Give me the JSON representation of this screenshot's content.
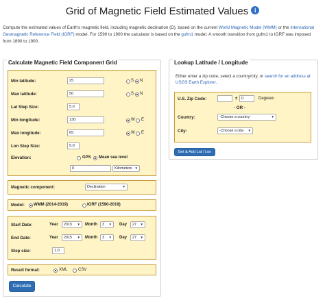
{
  "page": {
    "title": "Grid of Magnetic Field Estimated Values",
    "info_icon": "i"
  },
  "intro": {
    "t1": "Compute the estimated values of Earth's magnetic field, including magnetic declination (D), based on the current ",
    "link_wmm": "World Magnetic Model (WMM)",
    "t2": " or the ",
    "link_igrf": "International Geomagnetic Reference Field (IGRF)",
    "t3": " model. For 1590 to 1900 the calculator is based on the ",
    "link_gufm1": "gufm1",
    "t4": " model. A smooth transition from gufm1 to IGRF was imposed from 1890 to 1900."
  },
  "left": {
    "legend": "Calculate Magnetic Field Component Grid",
    "min_lat": {
      "label": "Min latitude:",
      "value": "25",
      "opt1": "S",
      "opt2": "N"
    },
    "max_lat": {
      "label": "Max latitude:",
      "value": "50",
      "opt1": "S",
      "opt2": "N"
    },
    "lat_step": {
      "label": "Lat Step Size:",
      "value": "5.0"
    },
    "min_lon": {
      "label": "Min longitude:",
      "value": "130",
      "opt1": "W",
      "opt2": "E"
    },
    "max_lon": {
      "label": "Max longitude:",
      "value": "65",
      "opt1": "W",
      "opt2": "E"
    },
    "lon_step": {
      "label": "Lon Step Size:",
      "value": "5.0"
    },
    "elevation": {
      "label": "Elevation:",
      "opt1": "GPS",
      "opt2": "Mean sea level",
      "value": "0",
      "unit": "Kilometers"
    },
    "component": {
      "label": "Magnetic component:",
      "value": "Declination"
    },
    "model": {
      "label": "Model:",
      "opt1": "WMM (2014-2019)",
      "opt2": "IGRF (1590-2019)"
    },
    "start": {
      "label": "Start Date:",
      "year": "2015",
      "month_label": "Month",
      "month": "3",
      "day_label": "Day",
      "day": "27"
    },
    "end": {
      "label": "End Date:",
      "year": "2015",
      "month_label": "Month",
      "month": "3",
      "day_label": "Day",
      "day": "27"
    },
    "step": {
      "label": "Step size:",
      "value": "1.0"
    },
    "format": {
      "label": "Result format:",
      "opt1": "XML",
      "opt2": "CSV"
    },
    "calculate": "Calculate"
  },
  "right": {
    "legend": "Lookup Latitude / Longitude",
    "desc_t1": "Either enter a zip code, select a country/city, or ",
    "desc_link": "search for an address at USGS Earth Explorer",
    "desc_t2": ".",
    "zip_label": "U.S. Zip Code:",
    "zip_pm": "±",
    "zip_radius": "0",
    "zip_unit": "Degrees",
    "or": "- OR -",
    "country_label": "Country:",
    "country_value": "-Choose a country-",
    "city_label": "City:",
    "city_value": "-Choose a city-",
    "button": "Get & Add Lat / Lon"
  }
}
